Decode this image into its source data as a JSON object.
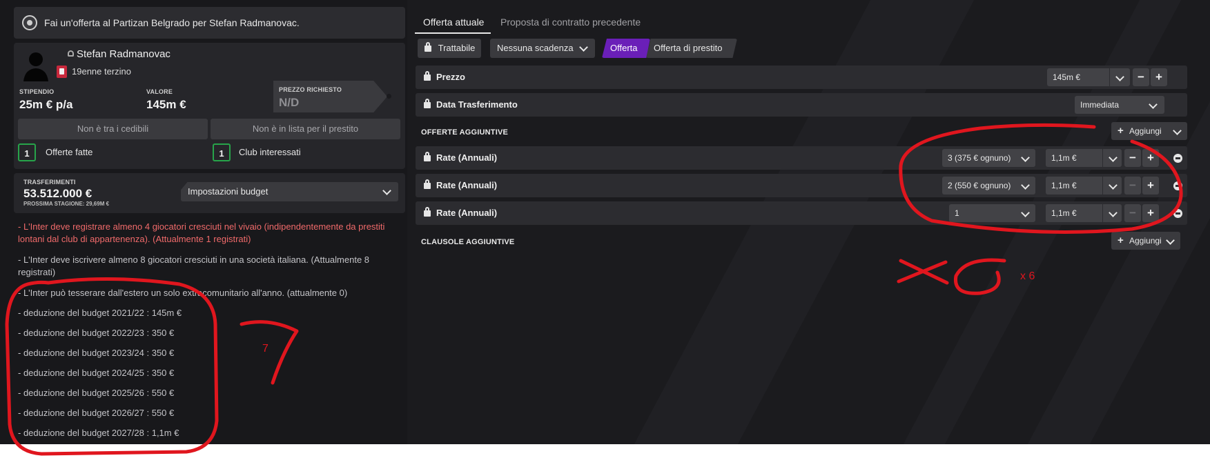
{
  "header": {
    "title": "Fai un'offerta al Partizan Belgrado per Stefan Radmanovac."
  },
  "player": {
    "name": "Stefan Radmanovac",
    "description": "19enne terzino",
    "salary_label": "STIPENDIO",
    "salary_value": "25m € p/a",
    "value_label": "VALORE",
    "value_value": "145m €",
    "asking_label": "PREZZO RICHIESTO",
    "asking_value": "N/D",
    "transfer_list_status": "Non è tra i cedibili",
    "loan_list_status": "Non è in lista per il prestito",
    "offers_count": "1",
    "offers_label": "Offerte fatte",
    "interested_count": "1",
    "interested_label": "Club interessati"
  },
  "budget": {
    "label": "TRASFERIMENTI",
    "amount": "53.512.000 €",
    "next_season": "PROSSIMA STAGIONE: 29,69M €",
    "settings_label": "Impostazioni budget"
  },
  "notes": [
    "- L'Inter deve registrare almeno 4 giocatori cresciuti nel vivaio (indipendentemente da prestiti lontani dal club di appartenenza). (Attualmente 1 registrati)",
    "- L'Inter deve iscrivere almeno 8 giocatori cresciuti in una società italiana. (Attualmente 8 registrati)",
    "- L'Inter può tesserare dall'estero un solo extracomunitario all'anno. (attualmente 0)",
    "- deduzione del budget 2021/22 : 145m €",
    "- deduzione del budget 2022/23 : 350 €",
    "- deduzione del budget 2023/24 : 350 €",
    "- deduzione del budget 2024/25 : 350 €",
    "- deduzione del budget 2025/26 : 550 €",
    "- deduzione del budget 2026/27 : 550 €",
    "- deduzione del budget 2027/28 : 1,1m €"
  ],
  "tabs": {
    "current": "Offerta attuale",
    "previous": "Proposta di contratto precedente"
  },
  "options": {
    "negotiable": "Trattabile",
    "deadline": "Nessuna scadenza",
    "offer": "Offerta",
    "loan_offer": "Offerta di prestito"
  },
  "rows": {
    "price_label": "Prezzo",
    "price_value": "145m €",
    "date_label": "Data Trasferimento",
    "date_value": "Immediata"
  },
  "additional_offers": {
    "title": "OFFERTE AGGIUNTIVE",
    "add_label": "Aggiungi",
    "installments": [
      {
        "label": "Rate (Annuali)",
        "count": "3 (375 € ognuno)",
        "amount": "1,1m €"
      },
      {
        "label": "Rate (Annuali)",
        "count": "2 (550 € ognuno)",
        "amount": "1,1m €"
      },
      {
        "label": "Rate (Annuali)",
        "count": "1",
        "amount": "1,1m €"
      }
    ]
  },
  "additional_clauses": {
    "title": "CLAUSOLE AGGIUNTIVE",
    "add_label": "Aggiungi"
  },
  "annotations": {
    "left": "7",
    "right": "x 6",
    "color": "#e0161e"
  },
  "colors": {
    "accent": "#6a1fb8",
    "count_border": "#27a44a",
    "warning": "#f06a6a"
  },
  "icons": {
    "club": "club-crest-icon",
    "lock": "lock-icon",
    "chevron": "chevron-down-icon",
    "plus": "plus-icon",
    "minus": "minus-icon"
  }
}
